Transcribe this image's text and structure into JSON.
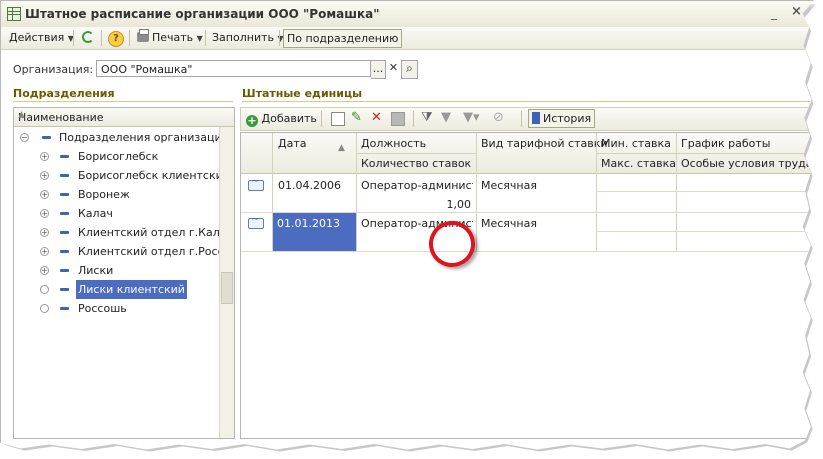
{
  "window": {
    "title": "Штатное расписание организации ООО \"Ромашка\"",
    "controls": [
      "_",
      "□",
      "×"
    ]
  },
  "toolbar": {
    "actions": "Действия",
    "help": "?",
    "print": "Печать",
    "fill": "Заполнить",
    "by_subdivision": "По подразделению"
  },
  "organization": {
    "label": "Организация:",
    "value": "ООО \"Ромашка\"",
    "select_btn": "...",
    "clear_btn": "✕",
    "search_btn": "⌕"
  },
  "subdivisions": {
    "header": "Подразделения",
    "column": "Наименование",
    "root": "Подразделения организации",
    "items": [
      {
        "label": "Борисоглебск",
        "expand": "+"
      },
      {
        "label": "Борисоглебск клиентский",
        "expand": "+"
      },
      {
        "label": "Воронеж",
        "expand": "+"
      },
      {
        "label": "Калач",
        "expand": "+"
      },
      {
        "label": "Клиентский отдел г.Калач",
        "expand": "+"
      },
      {
        "label": "Клиентский отдел г.Россошь",
        "expand": "+"
      },
      {
        "label": "Лиски",
        "expand": "+"
      },
      {
        "label": "Лиски клиентский",
        "expand": "",
        "selected": true
      },
      {
        "label": "Россошь",
        "expand": ""
      }
    ]
  },
  "staff_units": {
    "header": "Штатные единицы",
    "add_button": "Добавить",
    "history_button": "История",
    "columns": {
      "date": "Дата",
      "position": "Должность",
      "rate_count": "Количество ставок",
      "rate_type": "Вид тарифной ставки",
      "min_rate": "Мин. ставка",
      "max_rate": "Макс. ставка",
      "schedule": "График работы",
      "special_conditions": "Особые условия труда"
    },
    "rows": [
      {
        "date": "01.04.2006",
        "position": "Оператор-администратор",
        "rate_count": "1,00",
        "rate_type": "Месячная",
        "selected": false
      },
      {
        "date": "01.01.2013",
        "position": "Оператор-администратор",
        "rate_count": "",
        "rate_type": "Месячная",
        "selected": true
      }
    ]
  },
  "colors": {
    "selection": "#4b6cc1",
    "section_header": "#6b5a00",
    "annotation_circle": "#e0141e"
  }
}
